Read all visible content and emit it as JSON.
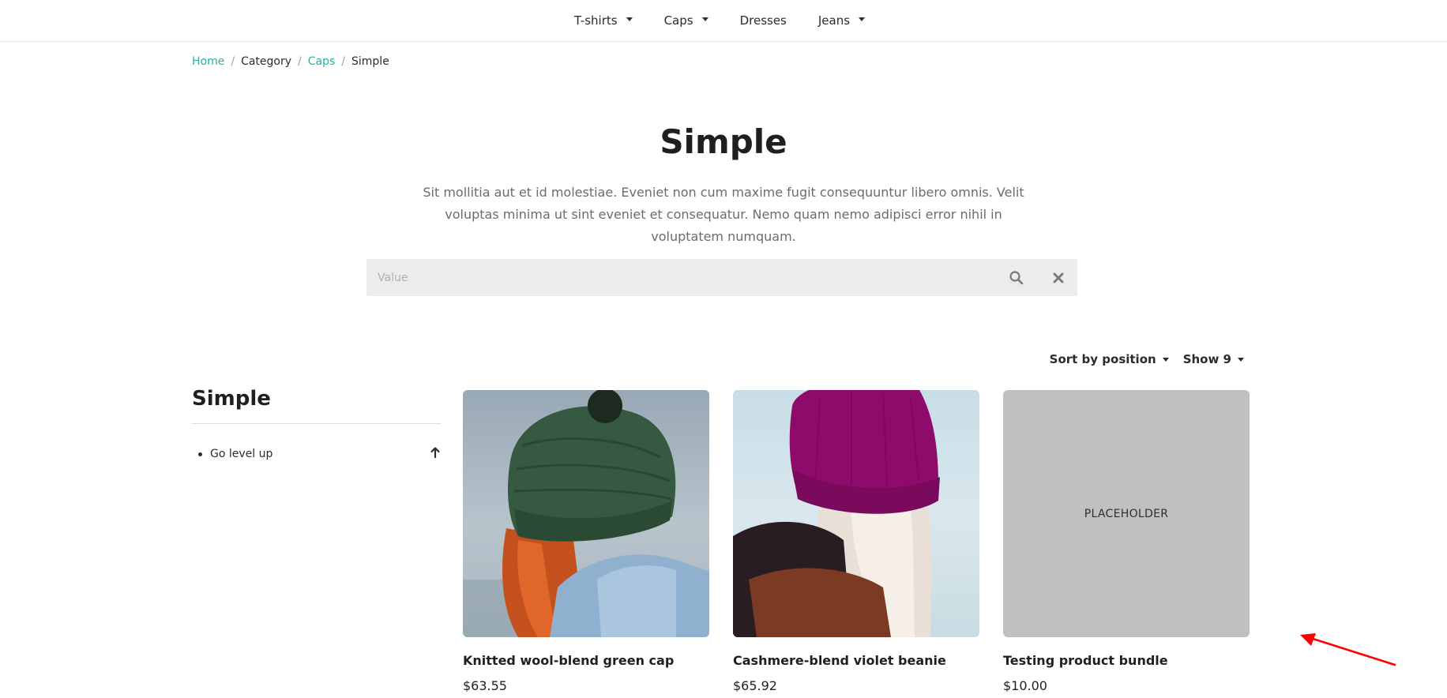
{
  "nav": {
    "items": [
      {
        "label": "T-shirts",
        "has_dropdown": true
      },
      {
        "label": "Caps",
        "has_dropdown": true
      },
      {
        "label": "Dresses",
        "has_dropdown": false
      },
      {
        "label": "Jeans",
        "has_dropdown": true
      }
    ]
  },
  "breadcrumb": {
    "home": "Home",
    "category": "Category",
    "caps": "Caps",
    "current": "Simple",
    "separator": "/"
  },
  "header": {
    "title": "Simple",
    "description": "Sit mollitia aut et id molestiae. Eveniet non cum maxime fugit consequuntur libero omnis. Velit voluptas minima ut sint eveniet et consequatur. Nemo quam nemo adipisci error nihil in voluptatem numquam."
  },
  "search": {
    "placeholder": "Value",
    "value": "",
    "search_icon": "search-icon",
    "clear_icon": "close-icon"
  },
  "toolbar": {
    "sort_label": "Sort by position",
    "show_label": "Show 9"
  },
  "sidebar": {
    "title": "Simple",
    "items": [
      {
        "label": "Go level up",
        "icon": "arrow-up-icon"
      }
    ]
  },
  "products": [
    {
      "name": "Knitted wool-blend green cap",
      "price": "$63.55"
    },
    {
      "name": "Cashmere-blend violet beanie",
      "price": "$65.92"
    },
    {
      "name": "Testing product bundle",
      "price": "$10.00",
      "image_text": "PLACEHOLDER"
    }
  ],
  "colors": {
    "accent": "#21b59b",
    "annotation": "#ff0000",
    "placeholder_bg": "#c0c0c0",
    "search_bg": "#ececec"
  }
}
